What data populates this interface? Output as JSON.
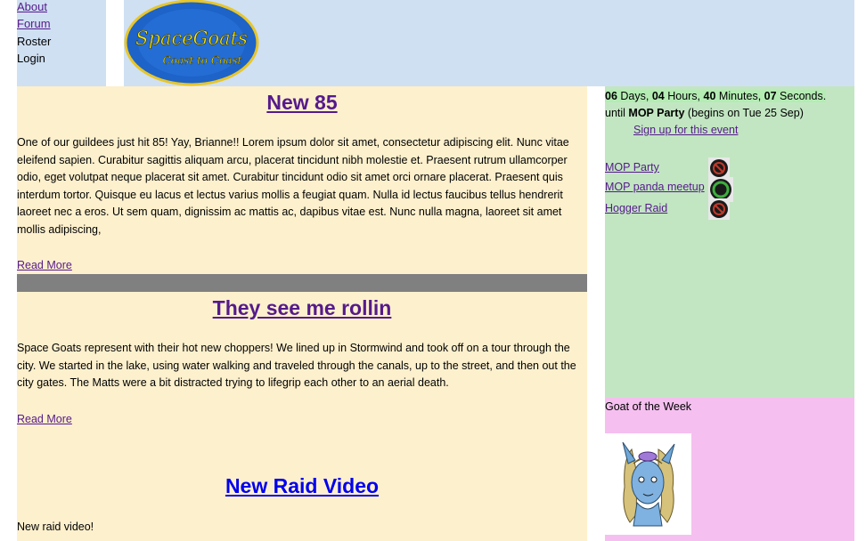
{
  "nav": {
    "items": [
      {
        "label": "About"
      },
      {
        "label": "Forum"
      },
      {
        "label": "Roster"
      },
      {
        "label": "Login"
      }
    ]
  },
  "logo": {
    "line1": "SpaceGoats",
    "line2": "Coast to Coast"
  },
  "posts": [
    {
      "title": "New 85",
      "body": "One of our guildees just hit 85! Yay, Brianne!! Lorem ipsum dolor sit amet, consectetur adipiscing elit. Nunc vitae eleifend sapien. Curabitur sagittis aliquam arcu, placerat tincidunt nibh molestie et. Praesent rutrum ullamcorper odio, eget volutpat neque placerat sit amet. Curabitur tincidunt odio sit amet orci ornare placerat. Praesent quis interdum tortor. Quisque eu lacus et lectus varius mollis a feugiat quam. Nulla id lectus faucibus tellus hendrerit laoreet nec a eros. Ut sem quam, dignissim ac mattis ac, dapibus vitae est. Nunc nulla magna, laoreet sit amet mollis adipiscing,",
      "read_more": "Read More"
    },
    {
      "title": "They see me rollin",
      "body": "Space Goats represent with their hot new choppers! We lined up in Stormwind and took off on a tour through the city. We started in the lake, using water walking and traveled through the canals, up to the street, and then out the city gates. The Matts were a bit distracted trying to lifegrip each other to an aerial death.",
      "read_more": "Read More"
    },
    {
      "title": "New Raid Video",
      "body": "New raid video!"
    }
  ],
  "countdown": {
    "days": "06",
    "days_label": "Days,",
    "hours": "04",
    "hours_label": "Hours,",
    "minutes": "40",
    "minutes_label": "Minutes,",
    "seconds": "07",
    "seconds_label": "Seconds.",
    "until": "until",
    "event": "MOP Party",
    "begins": "(begins on Tue 25 Sep)"
  },
  "signup": "Sign up for this event",
  "events": [
    {
      "label": "MOP Party"
    },
    {
      "label": "MOP panda meetup"
    },
    {
      "label": "Hogger Raid"
    }
  ],
  "goat_of_week": {
    "title": "Goat of the Week"
  }
}
